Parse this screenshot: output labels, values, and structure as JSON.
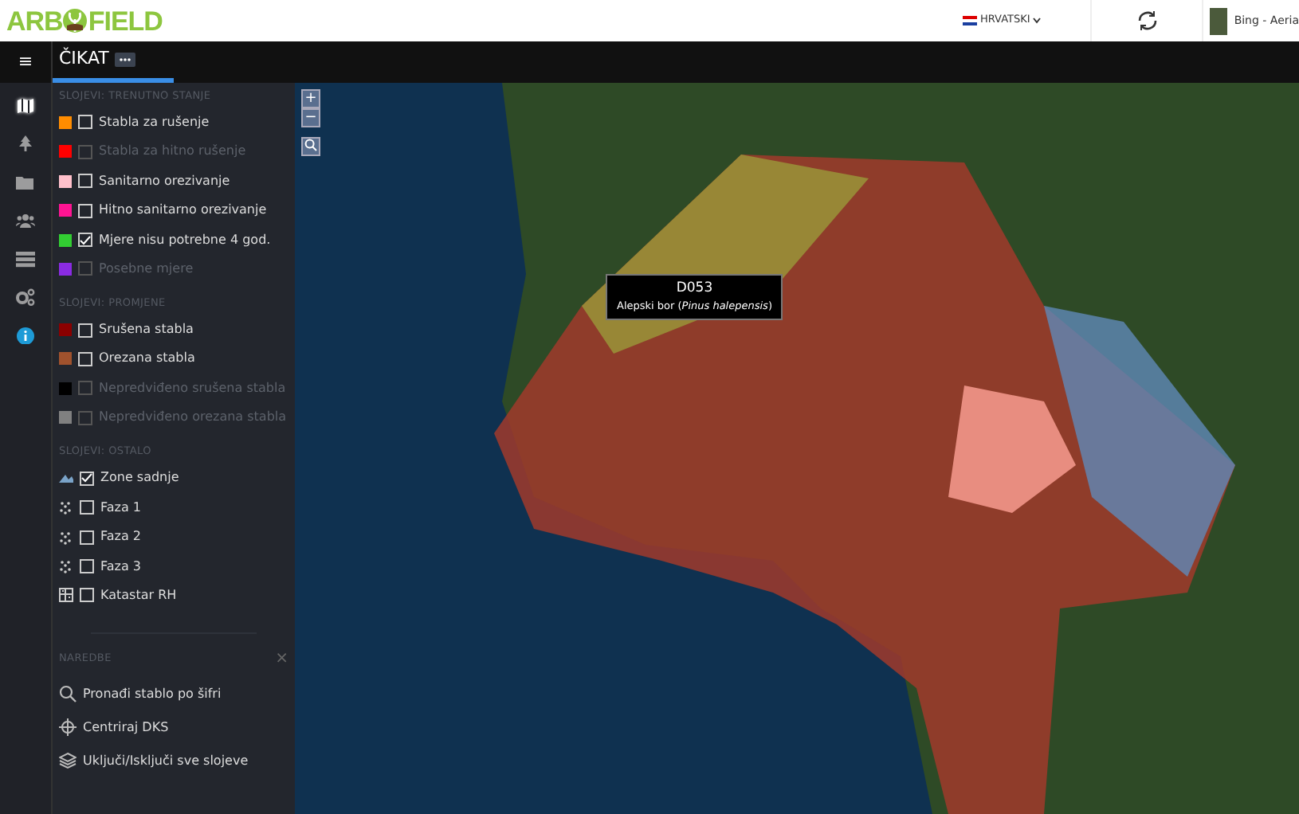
{
  "header": {
    "logo_left": "ARB",
    "logo_right": "FIELD",
    "language": "HRVATSKI",
    "basemap": "Bing - Aeria"
  },
  "toolbar": {
    "menu": "≡",
    "tabs": [
      {
        "label": "ČIKAT",
        "selected": true
      }
    ]
  },
  "rail": [
    {
      "kind": "map",
      "selected": true
    },
    {
      "kind": "tree",
      "selected": false
    },
    {
      "kind": "folder",
      "selected": false
    },
    {
      "kind": "users",
      "selected": false
    },
    {
      "kind": "server",
      "selected": false
    },
    {
      "kind": "gears",
      "selected": false
    },
    {
      "kind": "info",
      "selected": false
    }
  ],
  "sections": [
    {
      "title": "SLOJEVI: TRENUTNO STANJE",
      "items": [
        {
          "kind": "swatch",
          "color": "#ff8c00",
          "label": "Stabla za rušenje",
          "checked": false,
          "disabled": false
        },
        {
          "kind": "swatch",
          "color": "#ff0000",
          "label": "Stabla za hitno rušenje",
          "checked": false,
          "disabled": true
        },
        {
          "kind": "swatch",
          "color": "#ffc0cb",
          "label": "Sanitarno orezivanje",
          "checked": false,
          "disabled": false
        },
        {
          "kind": "swatch",
          "color": "#ff1493",
          "label": "Hitno sanitarno orezivanje",
          "checked": false,
          "disabled": false
        },
        {
          "kind": "swatch",
          "color": "#32cd32",
          "label": "Mjere nisu potrebne 4 god.",
          "checked": true,
          "disabled": false
        },
        {
          "kind": "swatch",
          "color": "#8a2be2",
          "label": "Posebne mjere",
          "checked": false,
          "disabled": true
        }
      ]
    },
    {
      "title": "SLOJEVI: PROMJENE",
      "items": [
        {
          "kind": "swatch",
          "color": "#8b0000",
          "label": "Srušena stabla",
          "checked": false,
          "disabled": false
        },
        {
          "kind": "swatch",
          "color": "#a0522d",
          "label": "Orezana stabla",
          "checked": false,
          "disabled": false
        },
        {
          "kind": "swatch",
          "color": "#000000",
          "label": "Nepredviđeno srušena stabla",
          "checked": false,
          "disabled": true
        },
        {
          "kind": "swatch",
          "color": "#808080",
          "label": "Nepredviđeno orezana stabla",
          "checked": false,
          "disabled": true
        }
      ]
    },
    {
      "title": "SLOJEVI: OSTALO",
      "items": [
        {
          "kind": "zone",
          "label": "Zone sadnje",
          "checked": true,
          "disabled": false
        },
        {
          "kind": "points",
          "label": "Faza 1",
          "checked": false,
          "disabled": false
        },
        {
          "kind": "points",
          "label": "Faza 2",
          "checked": false,
          "disabled": false
        },
        {
          "kind": "points",
          "label": "Faza 3",
          "checked": false,
          "disabled": false
        },
        {
          "kind": "cadastre",
          "label": "Katastar RH",
          "checked": false,
          "disabled": false
        }
      ]
    }
  ],
  "commands": {
    "title": "NAREDBE",
    "close": "×",
    "items": [
      {
        "kind": "search",
        "label": "Pronađi stablo po šifri"
      },
      {
        "kind": "crosshair",
        "label": "Centriraj DKS"
      },
      {
        "kind": "layers",
        "label": "Uključi/Isključi sve slojeve"
      }
    ]
  },
  "map": {
    "zoom_in": "+",
    "zoom_out": "−",
    "tooltip": {
      "title": "D053",
      "text": "Alepski bor (*Pinus halepensis*)"
    }
  }
}
